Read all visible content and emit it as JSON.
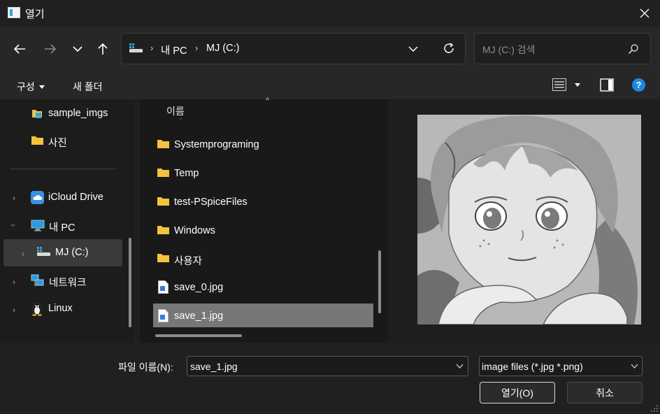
{
  "window": {
    "title": "열기"
  },
  "address": {
    "crumbs": [
      "내 PC",
      "MJ (C:)"
    ]
  },
  "search": {
    "placeholder": "MJ (C:) 검색"
  },
  "toolbar": {
    "organize_label": "구성",
    "new_folder_label": "새 폴더"
  },
  "nav": {
    "items": [
      {
        "label": "sample_imgs",
        "icon": "image-folder-icon"
      },
      {
        "label": "사진",
        "icon": "folder-icon"
      },
      {
        "label": "iCloud Drive",
        "icon": "cloud-icon"
      },
      {
        "label": "내 PC",
        "icon": "pc-icon"
      },
      {
        "label": "MJ (C:)",
        "icon": "drive-icon"
      },
      {
        "label": "네트워크",
        "icon": "network-icon"
      },
      {
        "label": "Linux",
        "icon": "linux-icon"
      }
    ],
    "selected": "MJ (C:)"
  },
  "filelist": {
    "column_header": "이름",
    "items": [
      {
        "label": "Systemprograming",
        "type": "folder"
      },
      {
        "label": "Temp",
        "type": "folder"
      },
      {
        "label": "test-PSpiceFiles",
        "type": "folder"
      },
      {
        "label": "Windows",
        "type": "folder"
      },
      {
        "label": "사용자",
        "type": "folder"
      },
      {
        "label": "save_0.jpg",
        "type": "image"
      },
      {
        "label": "save_1.jpg",
        "type": "image"
      }
    ],
    "selected": "save_1.jpg"
  },
  "bottom": {
    "filename_label": "파일 이름(N):",
    "filename_value": "save_1.jpg",
    "filetype_value": "image files (*.jpg *.png)",
    "open_label": "열기(O)",
    "cancel_label": "취소"
  },
  "colors": {
    "help": "#1e88e5",
    "folder": "#f3c33e",
    "selected_row": "#777777"
  }
}
